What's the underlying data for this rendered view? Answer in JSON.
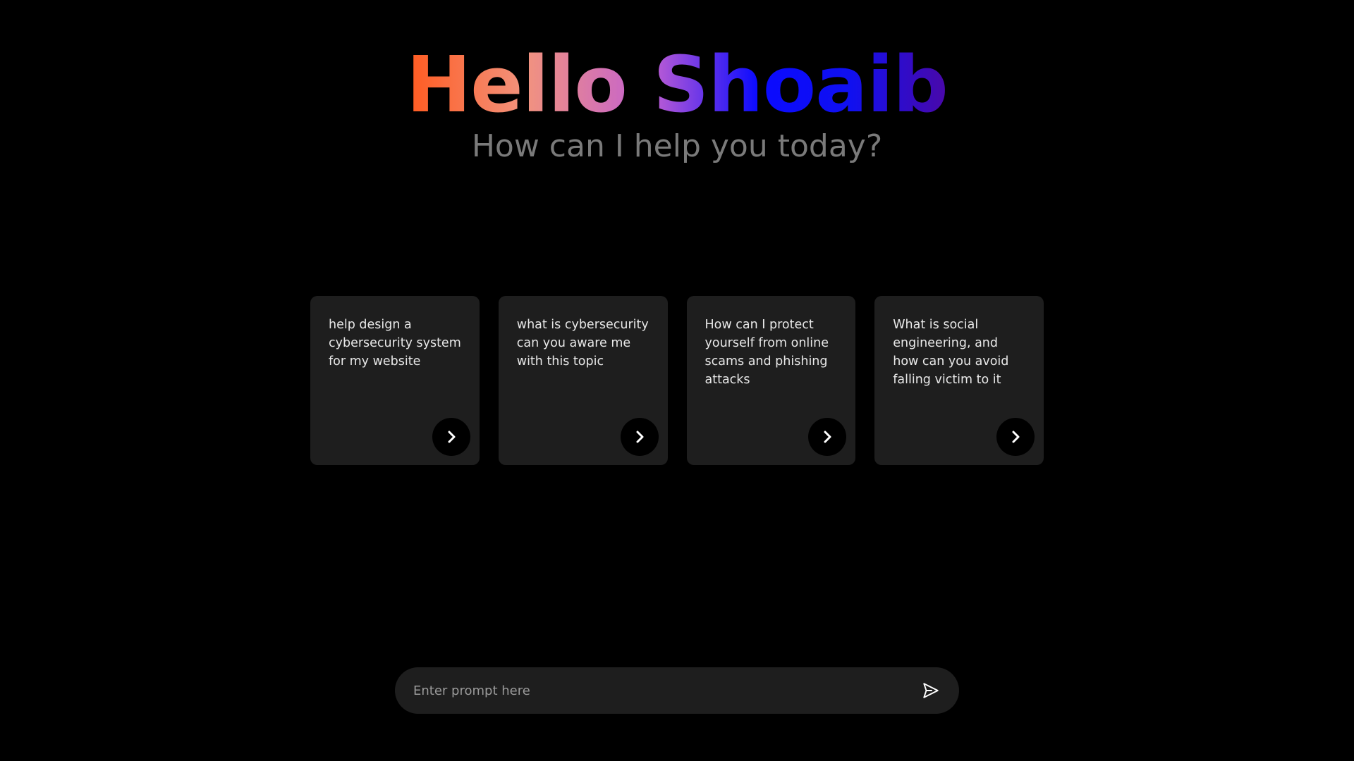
{
  "greeting": {
    "hello": "Hello Shoaib",
    "subtitle": "How can I help you today?"
  },
  "cards": [
    {
      "text": "help design a cybersecurity system for my website",
      "icon": "chevron-right-icon"
    },
    {
      "text": "what is cybersecurity can you aware me with this topic",
      "icon": "chevron-right-icon"
    },
    {
      "text": "How can I protect yourself from online scams and phishing attacks",
      "icon": "chevron-right-icon"
    },
    {
      "text": "What is social engineering, and how can you avoid falling victim to it",
      "icon": "chevron-right-icon"
    }
  ],
  "prompt": {
    "placeholder": "Enter prompt here",
    "value": "",
    "send_icon": "send-icon"
  },
  "colors": {
    "background": "#000000",
    "card": "#1e1e1e",
    "subtitle": "#7a7a7a",
    "gradient": [
      "#ff5a1f",
      "#f2937e",
      "#c25fd3",
      "#0a0aff",
      "#4a08a8"
    ]
  }
}
